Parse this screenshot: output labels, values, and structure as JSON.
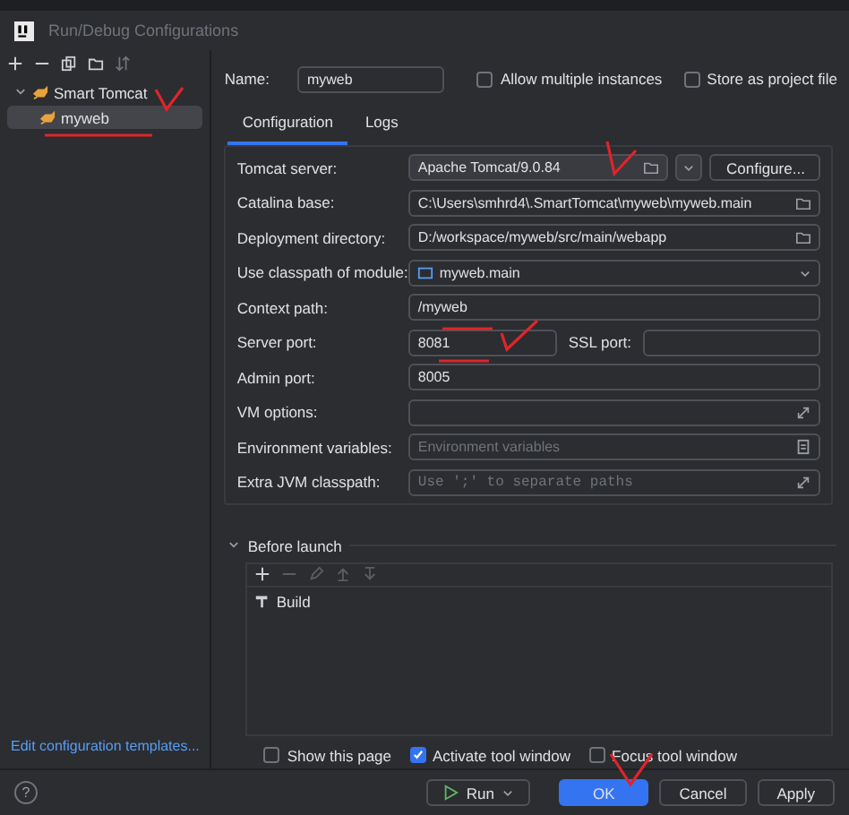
{
  "window": {
    "title": "Run/Debug Configurations"
  },
  "tree": [
    {
      "label": "Smart Tomcat",
      "expanded": true,
      "selected": false,
      "children": [
        {
          "label": "myweb",
          "selected": true
        }
      ]
    }
  ],
  "templates_link": "Edit configuration templates...",
  "name": {
    "label": "Name:",
    "value": "myweb"
  },
  "options": [
    {
      "label": "Allow multiple instances",
      "checked": false
    },
    {
      "label": "Store as project file",
      "checked": false
    }
  ],
  "tabs": [
    {
      "label": "Configuration",
      "selected": true
    },
    {
      "label": "Logs",
      "selected": false
    }
  ],
  "fields": [
    {
      "kind": "select",
      "label": "Tomcat server:",
      "value": "Apache Tomcat/9.0.84",
      "button": "Configure..."
    },
    {
      "kind": "path",
      "label": "Catalina base:",
      "value": "C:\\Users\\smhrd4\\.SmartTomcat\\myweb\\myweb.main"
    },
    {
      "kind": "path",
      "label": "Deployment directory:",
      "value": "D:/workspace/myweb/src/main/webapp"
    },
    {
      "kind": "module",
      "label": "Use classpath of module:",
      "value": "myweb.main"
    },
    {
      "kind": "text",
      "label": "Context path:",
      "value": "/myweb"
    },
    {
      "kind": "port",
      "label": "Server port:",
      "value": "8081",
      "second_label": "SSL port:"
    },
    {
      "kind": "text",
      "label": "Admin port:",
      "value": "8005"
    },
    {
      "kind": "expand",
      "label": "VM options:"
    },
    {
      "kind": "env",
      "label": "Environment variables:",
      "placeholder": "Environment variables"
    },
    {
      "kind": "expand",
      "label": "Extra JVM classpath:",
      "placeholder": "Use ';' to separate paths"
    }
  ],
  "before_launch": {
    "title": "Before launch",
    "expanded": true,
    "tasks": [
      "Build"
    ]
  },
  "launch_options": [
    {
      "label": "Show this page",
      "checked": false
    },
    {
      "label": "Activate tool window",
      "checked": true
    },
    {
      "label": "Focus tool window",
      "checked": false
    }
  ],
  "help": "?",
  "buttons": [
    {
      "kind": "run",
      "label": "Run"
    },
    {
      "kind": "primary",
      "label": "OK"
    },
    {
      "kind": "default",
      "label": "Cancel"
    },
    {
      "kind": "default",
      "label": "Apply"
    }
  ]
}
